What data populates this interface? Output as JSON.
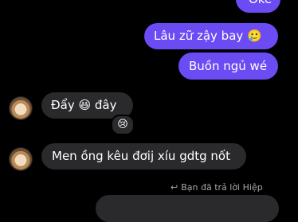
{
  "messages": [
    {
      "id": "oke",
      "text": "Oke",
      "direction": "out"
    },
    {
      "id": "lau",
      "text": "Lâu zữ zậy bay",
      "emoji": "🥲",
      "direction": "out"
    },
    {
      "id": "buon",
      "text": "Buồn ngủ wé",
      "direction": "out"
    },
    {
      "id": "day",
      "text_before": "Đẩy",
      "emoji": "😆",
      "text_after": "đây",
      "direction": "in",
      "reaction": "😢"
    },
    {
      "id": "men",
      "text": "Men ồng kêu đơij xíu gdtg nốt",
      "direction": "in"
    }
  ],
  "reply_note": {
    "icon": "↩",
    "text": "Bạn đã trả lời Hiệp"
  },
  "colors": {
    "outgoing": "#6b4bf3",
    "incoming": "#2a2a2c",
    "background": "#000000"
  }
}
